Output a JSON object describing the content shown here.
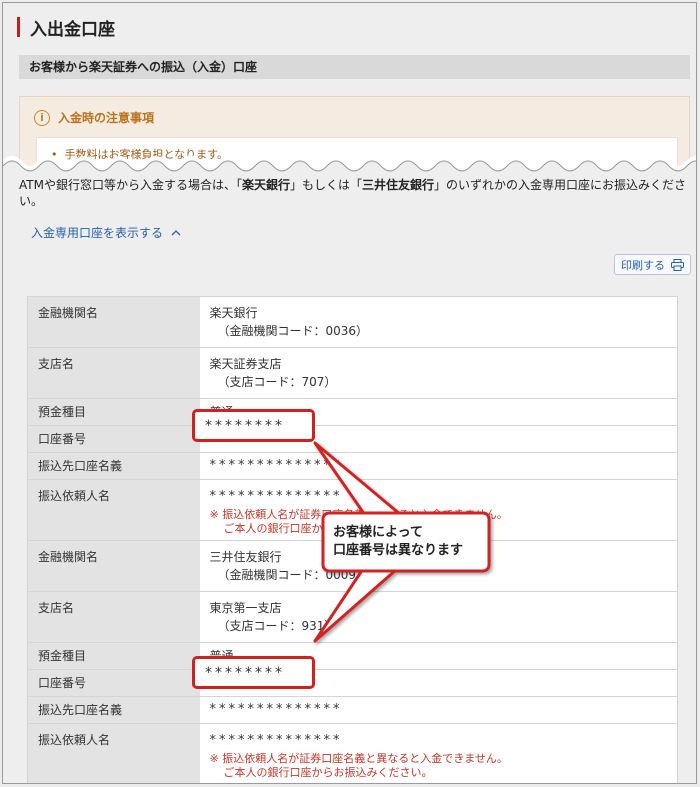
{
  "page": {
    "title": "入出金口座"
  },
  "section": {
    "header": "お客様から楽天証券への振込（入金）口座"
  },
  "notice": {
    "title": "入金時の注意事項",
    "items": [
      "手数料はお客様負担となります。"
    ]
  },
  "intro": {
    "part1": "ATMや銀行窓口等から入金する場合は、「",
    "bank1": "楽天銀行",
    "part2": "」もしくは「",
    "bank2": "三井住友銀行",
    "part3": "」のいずれかの入金専用口座にお振込みください。"
  },
  "toggle_link": "入金専用口座を表示する",
  "print_button": "印刷する",
  "accounts": [
    {
      "labels": {
        "bank": "金融機関名",
        "branch": "支店名",
        "type": "預金種目",
        "number": "口座番号",
        "holder": "振込先口座名義",
        "sender": "振込依頼人名"
      },
      "bank_name": "楽天銀行",
      "bank_code": "（金融機関コード：0036）",
      "branch_name": "楽天証券支店",
      "branch_code": "（支店コード：707）",
      "deposit_type": "普通",
      "account_number": "********",
      "holder": "**************",
      "sender": "**************",
      "note1": "※ 振込依頼人名が証券口座名義と異なると入金できません。",
      "note2": "ご本人の銀行口座からお振込みください。"
    },
    {
      "labels": {
        "bank": "金融機関名",
        "branch": "支店名",
        "type": "預金種目",
        "number": "口座番号",
        "holder": "振込先口座名義",
        "sender": "振込依頼人名"
      },
      "bank_name": "三井住友銀行",
      "bank_code": "（金融機関コード：0009）",
      "branch_name": "東京第一支店",
      "branch_code": "（支店コード：931）",
      "deposit_type": "普通",
      "account_number": "********",
      "holder": "**************",
      "sender": "**************",
      "note1": "※ 振込依頼人名が証券口座名義と異なると入金できません。",
      "note2": "ご本人の銀行口座からお振込みください。"
    }
  ],
  "callout": {
    "line1": "お客様によって",
    "line2": "口座番号は異なります"
  },
  "colors": {
    "accent": "#c41e1e",
    "link": "#2a5fa8",
    "notice": "#b8731c",
    "warning": "#c0392b"
  }
}
